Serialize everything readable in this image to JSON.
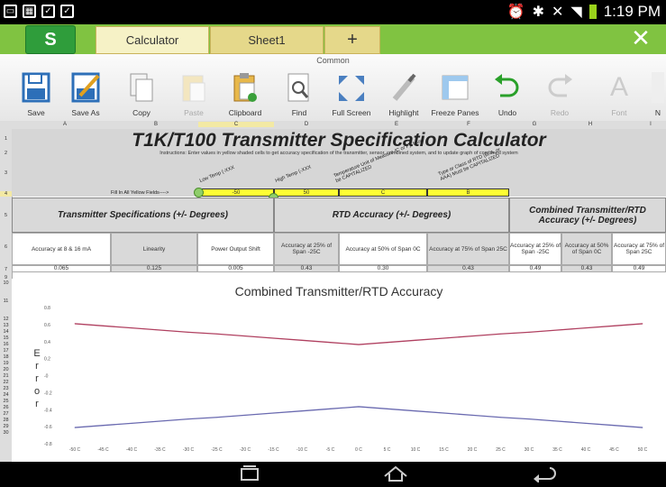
{
  "status_bar": {
    "time": "1:19 PM",
    "left_icons": [
      "screenshot-icon",
      "calendar-icon",
      "check-icon",
      "clipboard-check-icon"
    ],
    "right_icons": [
      "alarm-icon",
      "bluetooth-icon",
      "mute-icon",
      "wifi-icon",
      "battery-icon"
    ]
  },
  "tabs": {
    "app_logo": "S",
    "items": [
      {
        "label": "Calculator"
      },
      {
        "label": "Sheet1"
      },
      {
        "label": "+"
      }
    ],
    "close": "✕"
  },
  "ribbon": {
    "group_label": "Common",
    "buttons": [
      {
        "label": "Save",
        "icon": "save-icon",
        "enabled": true
      },
      {
        "label": "Save As",
        "icon": "save-as-icon",
        "enabled": true
      },
      {
        "label": "Copy",
        "icon": "copy-icon",
        "enabled": true
      },
      {
        "label": "Paste",
        "icon": "paste-icon",
        "enabled": false
      },
      {
        "label": "Clipboard",
        "icon": "clipboard-icon",
        "enabled": true
      },
      {
        "label": "Find",
        "icon": "find-icon",
        "enabled": true
      },
      {
        "label": "Full Screen",
        "icon": "full-screen-icon",
        "enabled": true
      },
      {
        "label": "Highlight",
        "icon": "highlight-icon",
        "enabled": true
      },
      {
        "label": "Freeze Panes",
        "icon": "freeze-panes-icon",
        "enabled": true
      },
      {
        "label": "Undo",
        "icon": "undo-icon",
        "enabled": true
      },
      {
        "label": "Redo",
        "icon": "redo-icon",
        "enabled": false
      },
      {
        "label": "Font",
        "icon": "font-icon",
        "enabled": false
      },
      {
        "label": "N",
        "icon": "number-format-icon",
        "enabled": false
      }
    ]
  },
  "sheet": {
    "columns": [
      "A",
      "B",
      "C",
      "D",
      "E",
      "F",
      "G",
      "H",
      "I"
    ],
    "rows": [
      "1",
      "2",
      "3",
      "4",
      "5",
      "6",
      "7",
      "9",
      "10",
      "11",
      "12",
      "13",
      "14",
      "15",
      "16",
      "17",
      "18",
      "19",
      "20",
      "21",
      "22",
      "23",
      "24",
      "25",
      "26",
      "27",
      "28",
      "29",
      "30"
    ],
    "title": "T1K/T100 Transmitter Specification Calculator",
    "instructions": "Instructions: Enter values in yellow shaded cells to get accuracy specification of the transmitter, sensor, combined system, and to update graph of combined system",
    "rotated_labels": [
      "Low Temp (-XXX",
      "High Temp (-XXX",
      "Temperature Unit of Measure (C or F), Must be CAPITALIZED",
      "Type or Class of RTD (B, A, or AAA) Must be CAPITALIZED"
    ],
    "fill_label": "Fill In All Yellow Fields---->",
    "inputs": {
      "low_temp": "-50",
      "high_temp": "50",
      "unit": "C",
      "rtd_class": "B"
    },
    "section_headers": [
      "Transmitter Specifications (+/- Degrees)",
      "RTD Accuracy (+/- Degrees)",
      "Combined Transmitter/RTD Accuracy (+/- Degrees)"
    ],
    "sub_headers": [
      "Accuracy at 8 & 16 mA",
      "Linearity",
      "Power Output Shift",
      "Accuracy at 25% of Span -25C",
      "Accuracy at 50% of Span 0C",
      "Accuracy at 75% of Span 25C",
      "Accuracy at 25% of Span -25C",
      "Accuracy at 50% of Span 0C",
      "Accuracy at 75% of Span 25C"
    ],
    "values": [
      "0.065",
      "0.125",
      "0.005",
      "0.43",
      "0.30",
      "0.43",
      "0.49",
      "0.43",
      "0.49"
    ]
  },
  "chart_data": {
    "type": "line",
    "title": "Combined Transmitter/RTD Accuracy",
    "ylabel": "Error",
    "ylim": [
      -0.8,
      0.8
    ],
    "yticks": [
      "0.8",
      "0.6",
      "0.4",
      "0.2",
      "-0",
      "-0.2",
      "-0.4",
      "-0.6",
      "-0.8"
    ],
    "categories": [
      "-50 C",
      "-45 C",
      "-40 C",
      "-35 C",
      "-30 C",
      "-25 C",
      "-20 C",
      "-15 C",
      "-10 C",
      "-5 C",
      "0 C",
      "5 C",
      "10 C",
      "15 C",
      "20 C",
      "25 C",
      "30 C",
      "35 C",
      "40 C",
      "45 C",
      "50 C"
    ],
    "series": [
      {
        "color": "#b04060",
        "values": [
          0.61,
          0.585,
          0.56,
          0.535,
          0.51,
          0.49,
          0.465,
          0.44,
          0.415,
          0.39,
          0.365,
          0.39,
          0.415,
          0.44,
          0.465,
          0.49,
          0.51,
          0.535,
          0.56,
          0.585,
          0.61
        ]
      },
      {
        "color": "#6a6ab0",
        "values": [
          -0.61,
          -0.585,
          -0.56,
          -0.535,
          -0.51,
          -0.49,
          -0.465,
          -0.44,
          -0.415,
          -0.39,
          -0.365,
          -0.39,
          -0.415,
          -0.44,
          -0.465,
          -0.49,
          -0.51,
          -0.535,
          -0.56,
          -0.585,
          -0.61
        ]
      }
    ]
  },
  "nav": {
    "recent_icon": "recent-apps-icon",
    "home_icon": "home-icon",
    "back_icon": "back-icon"
  }
}
